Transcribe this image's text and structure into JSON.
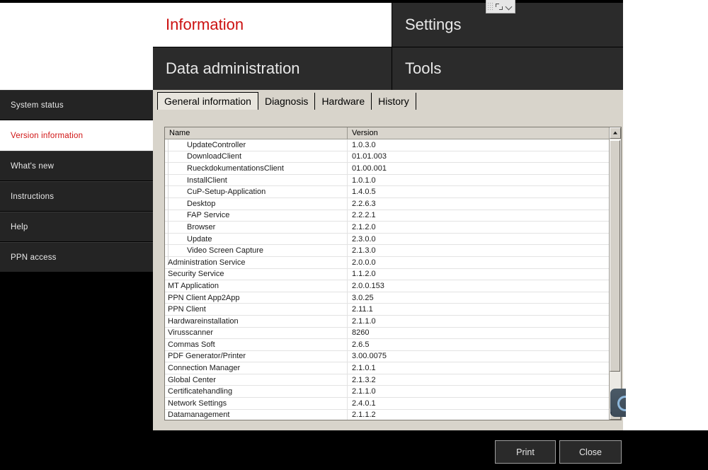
{
  "window": {
    "brand_panel_label": ""
  },
  "float_toolbar": {
    "grip_icon": "drag-grip-icon",
    "expand_icon": "fullscreen-expand-icon",
    "chevron_icon": "chevron-down-icon"
  },
  "nav_tiles": [
    {
      "id": "information",
      "label": "Information",
      "selected": true
    },
    {
      "id": "settings",
      "label": "Settings",
      "selected": false
    },
    {
      "id": "data-administration",
      "label": "Data administration",
      "selected": false
    },
    {
      "id": "tools",
      "label": "Tools",
      "selected": false
    }
  ],
  "sidebar": {
    "items": [
      {
        "id": "system-status",
        "label": "System status",
        "active": false
      },
      {
        "id": "version-information",
        "label": "Version information",
        "active": true
      },
      {
        "id": "whats-new",
        "label": "What's new",
        "active": false
      },
      {
        "id": "instructions",
        "label": "Instructions",
        "active": false
      },
      {
        "id": "help",
        "label": "Help",
        "active": false
      },
      {
        "id": "ppn-access",
        "label": "PPN access",
        "active": false
      }
    ]
  },
  "tabs": [
    {
      "id": "general-information",
      "label": "General information",
      "active": true
    },
    {
      "id": "diagnosis",
      "label": "Diagnosis",
      "active": false
    },
    {
      "id": "hardware",
      "label": "Hardware",
      "active": false
    },
    {
      "id": "history",
      "label": "History",
      "active": false
    }
  ],
  "table": {
    "columns": [
      "Name",
      "Version"
    ],
    "rows": [
      {
        "name": "UpdateController",
        "version": "1.0.3.0",
        "child": true
      },
      {
        "name": "DownloadClient",
        "version": "01.01.003",
        "child": true
      },
      {
        "name": "RueckdokumentationsClient",
        "version": "01.00.001",
        "child": true
      },
      {
        "name": "InstallClient",
        "version": "1.0.1.0",
        "child": true
      },
      {
        "name": "CuP-Setup-Application",
        "version": "1.4.0.5",
        "child": true
      },
      {
        "name": "Desktop",
        "version": "2.2.6.3",
        "child": true
      },
      {
        "name": "FAP Service",
        "version": "2.2.2.1",
        "child": true
      },
      {
        "name": "Browser",
        "version": "2.1.2.0",
        "child": true
      },
      {
        "name": "Update",
        "version": "2.3.0.0",
        "child": true
      },
      {
        "name": "Video Screen Capture",
        "version": "2.1.3.0",
        "child": true
      },
      {
        "name": "Administration Service",
        "version": "2.0.0.0",
        "child": false
      },
      {
        "name": "Security Service",
        "version": "1.1.2.0",
        "child": false
      },
      {
        "name": "MT Application",
        "version": "2.0.0.153",
        "child": false
      },
      {
        "name": "PPN Client App2App",
        "version": "3.0.25",
        "child": false
      },
      {
        "name": "PPN Client",
        "version": "2.11.1",
        "child": false
      },
      {
        "name": "Hardwareinstallation",
        "version": "2.1.1.0",
        "child": false
      },
      {
        "name": "Virusscanner",
        "version": "8260",
        "child": false
      },
      {
        "name": "Commas Soft",
        "version": "2.6.5",
        "child": false
      },
      {
        "name": "PDF Generator/Printer",
        "version": "3.00.0075",
        "child": false
      },
      {
        "name": "Connection Manager",
        "version": "2.1.0.1",
        "child": false
      },
      {
        "name": "Global Center",
        "version": "2.1.3.2",
        "child": false
      },
      {
        "name": "Certificatehandling",
        "version": "2.1.1.0",
        "child": false
      },
      {
        "name": "Network Settings",
        "version": "2.4.0.1",
        "child": false
      },
      {
        "name": "Datamanagement",
        "version": "2.1.1.2",
        "child": false
      }
    ]
  },
  "scrollbar": {
    "up_icon": "scroll-up-arrow-icon",
    "down_icon": "scroll-down-arrow-icon"
  },
  "footer": {
    "print_label": "Print",
    "close_label": "Close"
  },
  "colors": {
    "accent_red": "#cc1111",
    "panel_dark": "#2b2b2b",
    "sidebar_item": "#242424",
    "content_bg": "#d8d4cb",
    "table_bg": "#ffffff",
    "bottom_bar": "#000000"
  }
}
